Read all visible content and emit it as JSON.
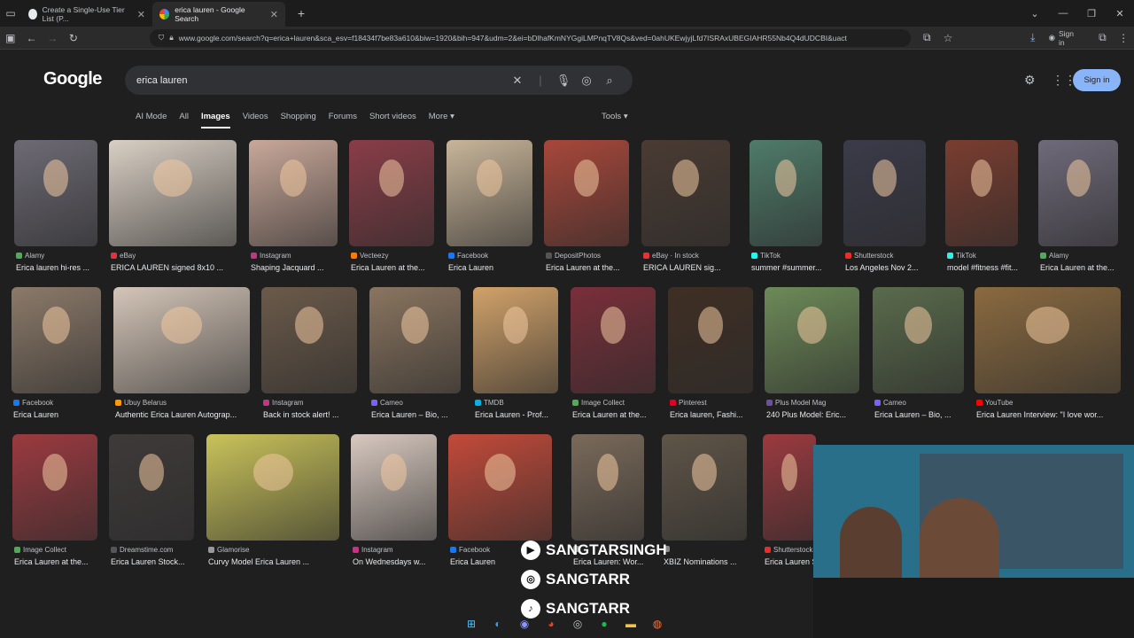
{
  "browser": {
    "tabs": [
      {
        "label": "Create a Single-Use Tier List (P..."
      },
      {
        "label": "erica lauren - Google Search",
        "active": true
      }
    ],
    "new_tab": "+",
    "url": "www.google.com/search?q=erica+lauren&sca_esv=f18434f7be83a610&biw=1920&bih=947&udm=2&ei=bDlhafKmNYGgiLMPnqTV8Qs&ved=0ahUKEwjyjLfd7ISRAxUBEGIAHR55Nb4Q4dUDCBI&uact",
    "signin_label": "Sign in"
  },
  "google": {
    "logo": "Google",
    "query": "erica lauren",
    "signin_button": "Sign in",
    "nav_tabs": [
      "AI Mode",
      "All",
      "Images",
      "Videos",
      "Shopping",
      "Forums",
      "Short videos",
      "More"
    ],
    "active_tab": "Images",
    "tools": "Tools"
  },
  "results": {
    "row1": [
      {
        "source": "Alamy",
        "title": "Erica lauren hi-res ...",
        "color": "#58a65c",
        "thumb": "#6d6a74"
      },
      {
        "source": "eBay",
        "title": "ERICA LAUREN signed 8x10 ...",
        "color": "#e53238",
        "thumb": "#d9cfc4"
      },
      {
        "source": "Instagram",
        "title": "Shaping Jacquard ...",
        "color": "#c13584",
        "thumb": "#c9a89a"
      },
      {
        "source": "Vecteezy",
        "title": "Erica Lauren at the...",
        "color": "#ff7a00",
        "thumb": "#8a3d48"
      },
      {
        "source": "Facebook",
        "title": "Erica Lauren",
        "color": "#1877f2",
        "thumb": "#c8b59a"
      },
      {
        "source": "DepositPhotos",
        "title": "Erica Lauren at the...",
        "color": "#555555",
        "thumb": "#a8473a"
      },
      {
        "source": "eBay · In stock",
        "title": "ERICA LAUREN sig...",
        "color": "#e53238",
        "thumb": "#4a3b33"
      },
      {
        "source": "TikTok",
        "title": "summer #summer...",
        "color": "#25f4ee",
        "thumb": "#4f7b6a"
      },
      {
        "source": "Shutterstock",
        "title": "Los Angeles Nov 2...",
        "color": "#ee2b24",
        "thumb": "#3b3b4a"
      },
      {
        "source": "TikTok",
        "title": "model #fitness #fit...",
        "color": "#25f4ee",
        "thumb": "#7a3d30"
      },
      {
        "source": "Alamy",
        "title": "Erica Lauren at the...",
        "color": "#58a65c",
        "thumb": "#6f6a7a"
      }
    ],
    "row2": [
      {
        "source": "Facebook",
        "title": "Erica Lauren",
        "color": "#1877f2",
        "thumb": "#8c7a6a"
      },
      {
        "source": "Ubuy Belarus",
        "title": "Authentic Erica Lauren Autograp...",
        "color": "#ff9900",
        "thumb": "#d4c5b8"
      },
      {
        "source": "Instagram",
        "title": "Back in stock alert! ...",
        "color": "#c13584",
        "thumb": "#6b5a4a"
      },
      {
        "source": "Cameo",
        "title": "Erica Lauren – Bio, ...",
        "color": "#7b61ff",
        "thumb": "#8a7560"
      },
      {
        "source": "TMDB",
        "title": "Erica Lauren - Prof...",
        "color": "#01b4e4",
        "thumb": "#d1a26a"
      },
      {
        "source": "Image Collect",
        "title": "Erica Lauren at the...",
        "color": "#58a65c",
        "thumb": "#7a2f3a"
      },
      {
        "source": "Pinterest",
        "title": "Erica lauren, Fashi...",
        "color": "#e60023",
        "thumb": "#3f2f24"
      },
      {
        "source": "Plus Model Mag",
        "title": "240 Plus Model: Eric...",
        "color": "#6a4fa3",
        "thumb": "#6d8a58"
      },
      {
        "source": "Cameo",
        "title": "Erica Lauren – Bio, ...",
        "color": "#7b61ff",
        "thumb": "#5a6b4c"
      },
      {
        "source": "YouTube",
        "title": "Erica Lauren Interview: \"I love wor...",
        "color": "#ff0000",
        "thumb": "#8a6a40"
      }
    ],
    "row3": [
      {
        "source": "Image Collect",
        "title": "Erica Lauren at the...",
        "color": "#58a65c",
        "thumb": "#9b3a40"
      },
      {
        "source": "Dreamstime.com",
        "title": "Erica Lauren Stock...",
        "color": "#555555",
        "thumb": "#3f3a3a"
      },
      {
        "source": "Glamorise",
        "title": "Curvy Model Erica Lauren ...",
        "color": "#999999",
        "thumb": "#c9c35a"
      },
      {
        "source": "Instagram",
        "title": "On Wednesdays w...",
        "color": "#c13584",
        "thumb": "#d8c9c0"
      },
      {
        "source": "Facebook",
        "title": "Erica Lauren",
        "color": "#1877f2",
        "thumb": "#c24a3a"
      },
      {
        "source": "",
        "title": "Erica Lauren: Wor...",
        "color": "#888888",
        "thumb": "#7a6a5a"
      },
      {
        "source": "",
        "title": "XBIZ Nominations ...",
        "color": "#888888",
        "thumb": "#5f5548"
      },
      {
        "source": "Shutterstock",
        "title": "Erica Lauren S...",
        "color": "#ee2b24",
        "thumb": "#9b3a40"
      }
    ]
  },
  "stream_overlay": {
    "lines": [
      "SANGTARSINGH",
      "SANGTARR",
      "SANGTARR"
    ],
    "icons": [
      "play-icon",
      "instagram-icon",
      "tiktok-icon"
    ]
  }
}
